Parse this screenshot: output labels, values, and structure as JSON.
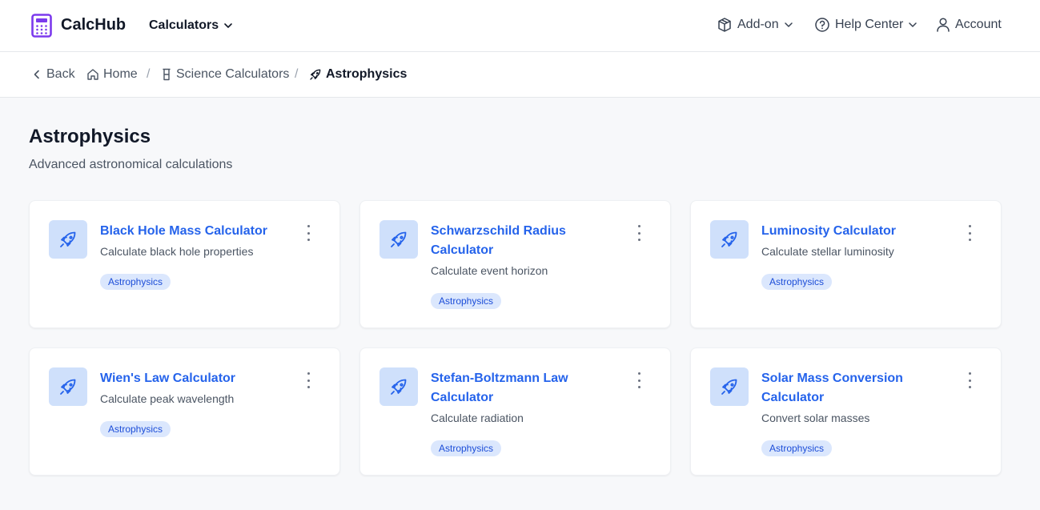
{
  "header": {
    "brand": "CalcHub",
    "calculators_label": "Calculators",
    "addon_label": "Add-on",
    "help_label": "Help Center",
    "account_label": "Account"
  },
  "breadcrumb": {
    "back": "Back",
    "home": "Home",
    "science": "Science Calculators",
    "current": "Astrophysics",
    "separator": "/"
  },
  "page": {
    "title": "Astrophysics",
    "subtitle": "Advanced astronomical calculations"
  },
  "cards": [
    {
      "title": "Black Hole Mass Calculator",
      "description": "Calculate black hole properties",
      "tag": "Astrophysics"
    },
    {
      "title": "Schwarzschild Radius Calculator",
      "description": "Calculate event horizon",
      "tag": "Astrophysics"
    },
    {
      "title": "Luminosity Calculator",
      "description": "Calculate stellar luminosity",
      "tag": "Astrophysics"
    },
    {
      "title": "Wien's Law Calculator",
      "description": "Calculate peak wavelength",
      "tag": "Astrophysics"
    },
    {
      "title": "Stefan-Boltzmann Law Calculator",
      "description": "Calculate radiation",
      "tag": "Astrophysics"
    },
    {
      "title": "Solar Mass Conversion Calculator",
      "description": "Convert solar masses",
      "tag": "Astrophysics"
    }
  ],
  "icons": {
    "logo": "calculator-icon",
    "card": "rocket-icon",
    "menu": "more-vertical-icon"
  },
  "colors": {
    "accent": "#2563eb",
    "brand": "#7c3aed",
    "tag_bg": "#dbe7fd",
    "icon_bg": "#cfe0fb"
  }
}
